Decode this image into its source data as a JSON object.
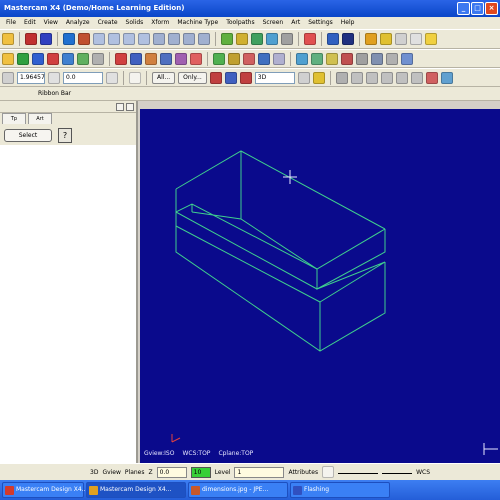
{
  "window": {
    "title": "Mastercam X4 (Demo/Home Learning Edition)",
    "buttons": [
      "_",
      "□",
      "×"
    ]
  },
  "menu": [
    "File",
    "Edit",
    "View",
    "Analyze",
    "Create",
    "Solids",
    "Xform",
    "Machine Type",
    "Toolpaths",
    "Screen",
    "Art",
    "Settings",
    "Help"
  ],
  "toolbar3": {
    "field1": "1.96457",
    "field2": "0.0",
    "all_button": "All...",
    "only_button": "Only...",
    "dropdown": "3D"
  },
  "ribbon": {
    "label": "Ribbon Bar"
  },
  "operations": {
    "tabs": [
      "Tp",
      "Art"
    ],
    "select_button": "Select",
    "help_button": "?"
  },
  "viewport": {
    "gview": "Gview:ISO",
    "wcs": "WCS:TOP",
    "cplane": "Cplane:TOP"
  },
  "statusbar": {
    "view": "3D",
    "gview": "Gview",
    "planes": "Planes",
    "z_label": "Z",
    "z_value": "0.0",
    "color_value": "10",
    "level_label": "Level",
    "level_value": "1",
    "attributes": "Attributes",
    "wcs": "WCS"
  },
  "taskbar": [
    {
      "label": "Mastercam Design X4...",
      "icon_color": "#d33a2c"
    },
    {
      "label": "Mastercam Design X4...",
      "icon_color": "#e0a020"
    },
    {
      "label": "dimensions.jpg - JPE...",
      "icon_color": "#c8582a"
    },
    {
      "label": "Flashing",
      "icon_color": "#3050c0"
    }
  ],
  "colors": {
    "viewport_bg": "#0a0a8c",
    "wireframe": "#3fcf8e",
    "status_green": "#37d037",
    "taskbar": "#245ed8"
  }
}
